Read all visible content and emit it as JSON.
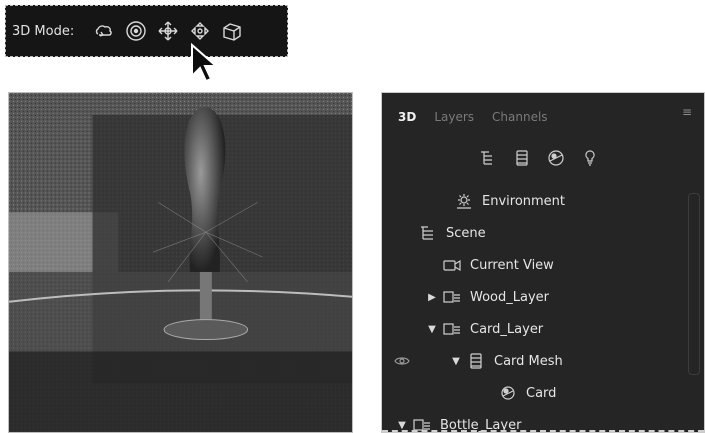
{
  "toolbar": {
    "label": "3D Mode:",
    "icons": [
      "orbit-icon",
      "roll-icon",
      "pan-icon",
      "slide-icon",
      "scale-icon"
    ]
  },
  "panel": {
    "tabs": [
      {
        "label": "3D",
        "active": true
      },
      {
        "label": "Layers",
        "active": false
      },
      {
        "label": "Channels",
        "active": false
      }
    ],
    "filters": [
      "scene-filter-icon",
      "mesh-filter-icon",
      "material-filter-icon",
      "light-filter-icon"
    ],
    "tree": [
      {
        "label": "Environment",
        "icon": "environment-icon",
        "level": 0,
        "arrow": "",
        "eye": false
      },
      {
        "label": "Scene",
        "icon": "scene-icon",
        "level": 0,
        "arrow": "",
        "eye": false
      },
      {
        "label": "Current View",
        "icon": "camera-icon",
        "level": 1,
        "arrow": "",
        "eye": false
      },
      {
        "label": "Wood_Layer",
        "icon": "layer-icon",
        "level": 0,
        "arrow": "▶",
        "eye": false
      },
      {
        "label": "Card_Layer",
        "icon": "layer-icon",
        "level": 0,
        "arrow": "▼",
        "eye": false
      },
      {
        "label": "Card Mesh",
        "icon": "mesh-icon",
        "level": 1,
        "arrow": "▼",
        "eye": true
      },
      {
        "label": "Card",
        "icon": "material-icon",
        "level": 2,
        "arrow": "",
        "eye": false
      },
      {
        "label": "Bottle_Layer",
        "icon": "layer-icon",
        "level": 0,
        "arrow": "▼",
        "eye": false
      }
    ]
  }
}
